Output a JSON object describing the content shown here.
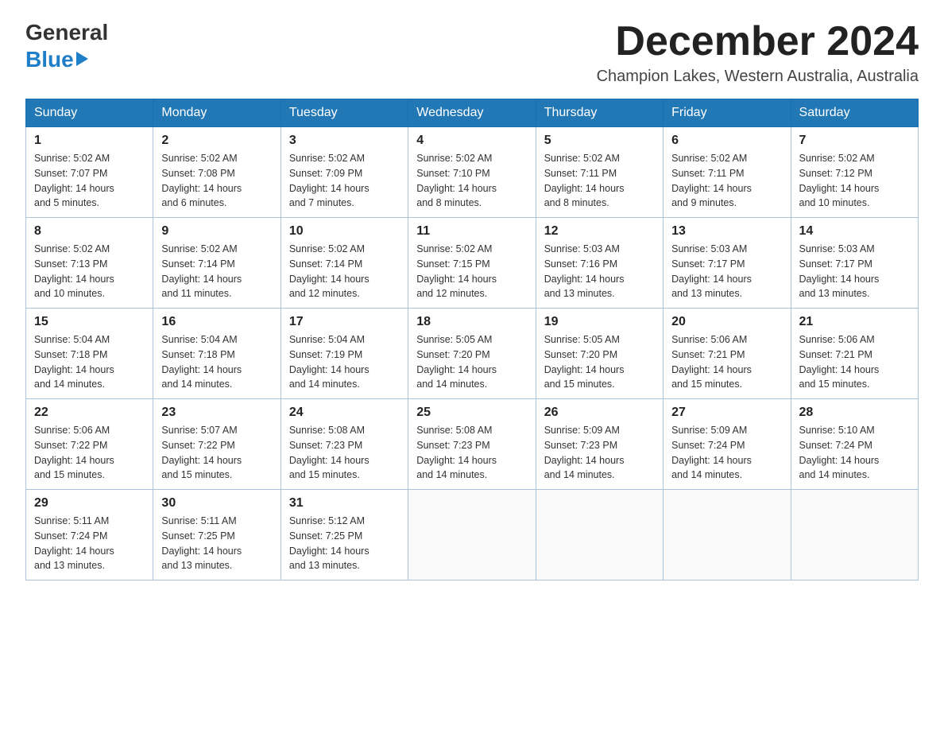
{
  "header": {
    "logo_line1": "General",
    "logo_line2": "Blue",
    "month_title": "December 2024",
    "location": "Champion Lakes, Western Australia, Australia"
  },
  "days_of_week": [
    "Sunday",
    "Monday",
    "Tuesday",
    "Wednesday",
    "Thursday",
    "Friday",
    "Saturday"
  ],
  "weeks": [
    [
      {
        "day": "1",
        "sunrise": "5:02 AM",
        "sunset": "7:07 PM",
        "daylight": "14 hours and 5 minutes."
      },
      {
        "day": "2",
        "sunrise": "5:02 AM",
        "sunset": "7:08 PM",
        "daylight": "14 hours and 6 minutes."
      },
      {
        "day": "3",
        "sunrise": "5:02 AM",
        "sunset": "7:09 PM",
        "daylight": "14 hours and 7 minutes."
      },
      {
        "day": "4",
        "sunrise": "5:02 AM",
        "sunset": "7:10 PM",
        "daylight": "14 hours and 8 minutes."
      },
      {
        "day": "5",
        "sunrise": "5:02 AM",
        "sunset": "7:11 PM",
        "daylight": "14 hours and 8 minutes."
      },
      {
        "day": "6",
        "sunrise": "5:02 AM",
        "sunset": "7:11 PM",
        "daylight": "14 hours and 9 minutes."
      },
      {
        "day": "7",
        "sunrise": "5:02 AM",
        "sunset": "7:12 PM",
        "daylight": "14 hours and 10 minutes."
      }
    ],
    [
      {
        "day": "8",
        "sunrise": "5:02 AM",
        "sunset": "7:13 PM",
        "daylight": "14 hours and 10 minutes."
      },
      {
        "day": "9",
        "sunrise": "5:02 AM",
        "sunset": "7:14 PM",
        "daylight": "14 hours and 11 minutes."
      },
      {
        "day": "10",
        "sunrise": "5:02 AM",
        "sunset": "7:14 PM",
        "daylight": "14 hours and 12 minutes."
      },
      {
        "day": "11",
        "sunrise": "5:02 AM",
        "sunset": "7:15 PM",
        "daylight": "14 hours and 12 minutes."
      },
      {
        "day": "12",
        "sunrise": "5:03 AM",
        "sunset": "7:16 PM",
        "daylight": "14 hours and 13 minutes."
      },
      {
        "day": "13",
        "sunrise": "5:03 AM",
        "sunset": "7:17 PM",
        "daylight": "14 hours and 13 minutes."
      },
      {
        "day": "14",
        "sunrise": "5:03 AM",
        "sunset": "7:17 PM",
        "daylight": "14 hours and 13 minutes."
      }
    ],
    [
      {
        "day": "15",
        "sunrise": "5:04 AM",
        "sunset": "7:18 PM",
        "daylight": "14 hours and 14 minutes."
      },
      {
        "day": "16",
        "sunrise": "5:04 AM",
        "sunset": "7:18 PM",
        "daylight": "14 hours and 14 minutes."
      },
      {
        "day": "17",
        "sunrise": "5:04 AM",
        "sunset": "7:19 PM",
        "daylight": "14 hours and 14 minutes."
      },
      {
        "day": "18",
        "sunrise": "5:05 AM",
        "sunset": "7:20 PM",
        "daylight": "14 hours and 14 minutes."
      },
      {
        "day": "19",
        "sunrise": "5:05 AM",
        "sunset": "7:20 PM",
        "daylight": "14 hours and 15 minutes."
      },
      {
        "day": "20",
        "sunrise": "5:06 AM",
        "sunset": "7:21 PM",
        "daylight": "14 hours and 15 minutes."
      },
      {
        "day": "21",
        "sunrise": "5:06 AM",
        "sunset": "7:21 PM",
        "daylight": "14 hours and 15 minutes."
      }
    ],
    [
      {
        "day": "22",
        "sunrise": "5:06 AM",
        "sunset": "7:22 PM",
        "daylight": "14 hours and 15 minutes."
      },
      {
        "day": "23",
        "sunrise": "5:07 AM",
        "sunset": "7:22 PM",
        "daylight": "14 hours and 15 minutes."
      },
      {
        "day": "24",
        "sunrise": "5:08 AM",
        "sunset": "7:23 PM",
        "daylight": "14 hours and 15 minutes."
      },
      {
        "day": "25",
        "sunrise": "5:08 AM",
        "sunset": "7:23 PM",
        "daylight": "14 hours and 14 minutes."
      },
      {
        "day": "26",
        "sunrise": "5:09 AM",
        "sunset": "7:23 PM",
        "daylight": "14 hours and 14 minutes."
      },
      {
        "day": "27",
        "sunrise": "5:09 AM",
        "sunset": "7:24 PM",
        "daylight": "14 hours and 14 minutes."
      },
      {
        "day": "28",
        "sunrise": "5:10 AM",
        "sunset": "7:24 PM",
        "daylight": "14 hours and 14 minutes."
      }
    ],
    [
      {
        "day": "29",
        "sunrise": "5:11 AM",
        "sunset": "7:24 PM",
        "daylight": "14 hours and 13 minutes."
      },
      {
        "day": "30",
        "sunrise": "5:11 AM",
        "sunset": "7:25 PM",
        "daylight": "14 hours and 13 minutes."
      },
      {
        "day": "31",
        "sunrise": "5:12 AM",
        "sunset": "7:25 PM",
        "daylight": "14 hours and 13 minutes."
      },
      null,
      null,
      null,
      null
    ]
  ],
  "labels": {
    "sunrise": "Sunrise:",
    "sunset": "Sunset:",
    "daylight": "Daylight:"
  }
}
